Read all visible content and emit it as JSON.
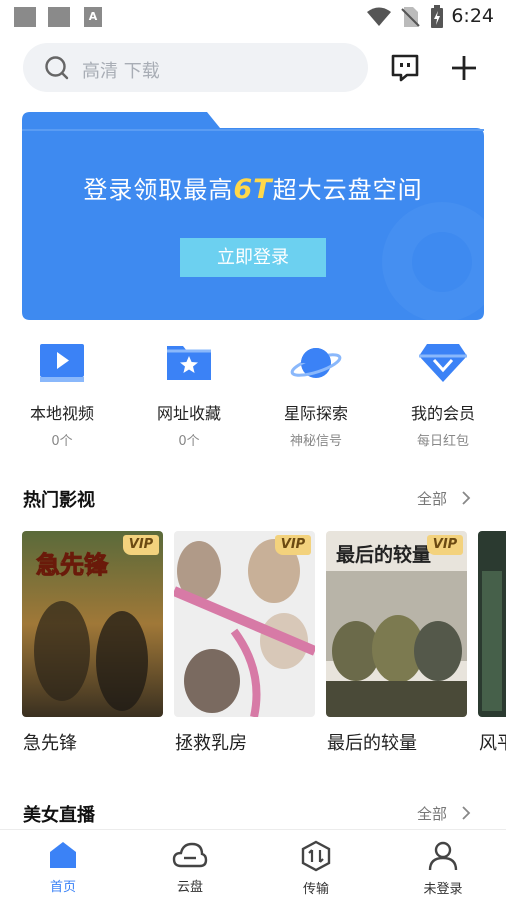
{
  "status_bar": {
    "time": "6:24"
  },
  "search": {
    "placeholder": "高清 下载"
  },
  "top_icons": [
    "message-square-icon",
    "plus-icon"
  ],
  "banner": {
    "text_before": "登录领取最高",
    "highlight": "6T",
    "text_after": "超大云盘空间",
    "button_label": "立即登录"
  },
  "quick_entries": [
    {
      "label": "本地视频",
      "sub": "0个",
      "icon": "play-screen-icon"
    },
    {
      "label": "网址收藏",
      "sub": "0个",
      "icon": "star-folder-icon"
    },
    {
      "label": "星际探索",
      "sub": "神秘信号",
      "icon": "planet-icon"
    },
    {
      "label": "我的会员",
      "sub": "每日红包",
      "icon": "diamond-icon"
    }
  ],
  "section_hot": {
    "title": "热门影视",
    "more": "全部"
  },
  "movies": [
    {
      "title": "急先锋",
      "badge": "VIP"
    },
    {
      "title": "拯救乳房",
      "badge": "VIP"
    },
    {
      "title": "最后的较量",
      "badge": "VIP"
    },
    {
      "title": "风平"
    }
  ],
  "section_live": {
    "title": "美女直播",
    "more": "全部"
  },
  "tabs": [
    {
      "label": "首页",
      "icon": "home-icon",
      "active": true
    },
    {
      "label": "云盘",
      "icon": "cloud-icon"
    },
    {
      "label": "传输",
      "icon": "transfer-icon"
    },
    {
      "label": "未登录",
      "icon": "user-icon"
    }
  ],
  "colors": {
    "accent": "#3b82f6",
    "banner": "#3e8af0",
    "login_button": "#6cd0f0",
    "vip_badge": "#f3d27d"
  }
}
